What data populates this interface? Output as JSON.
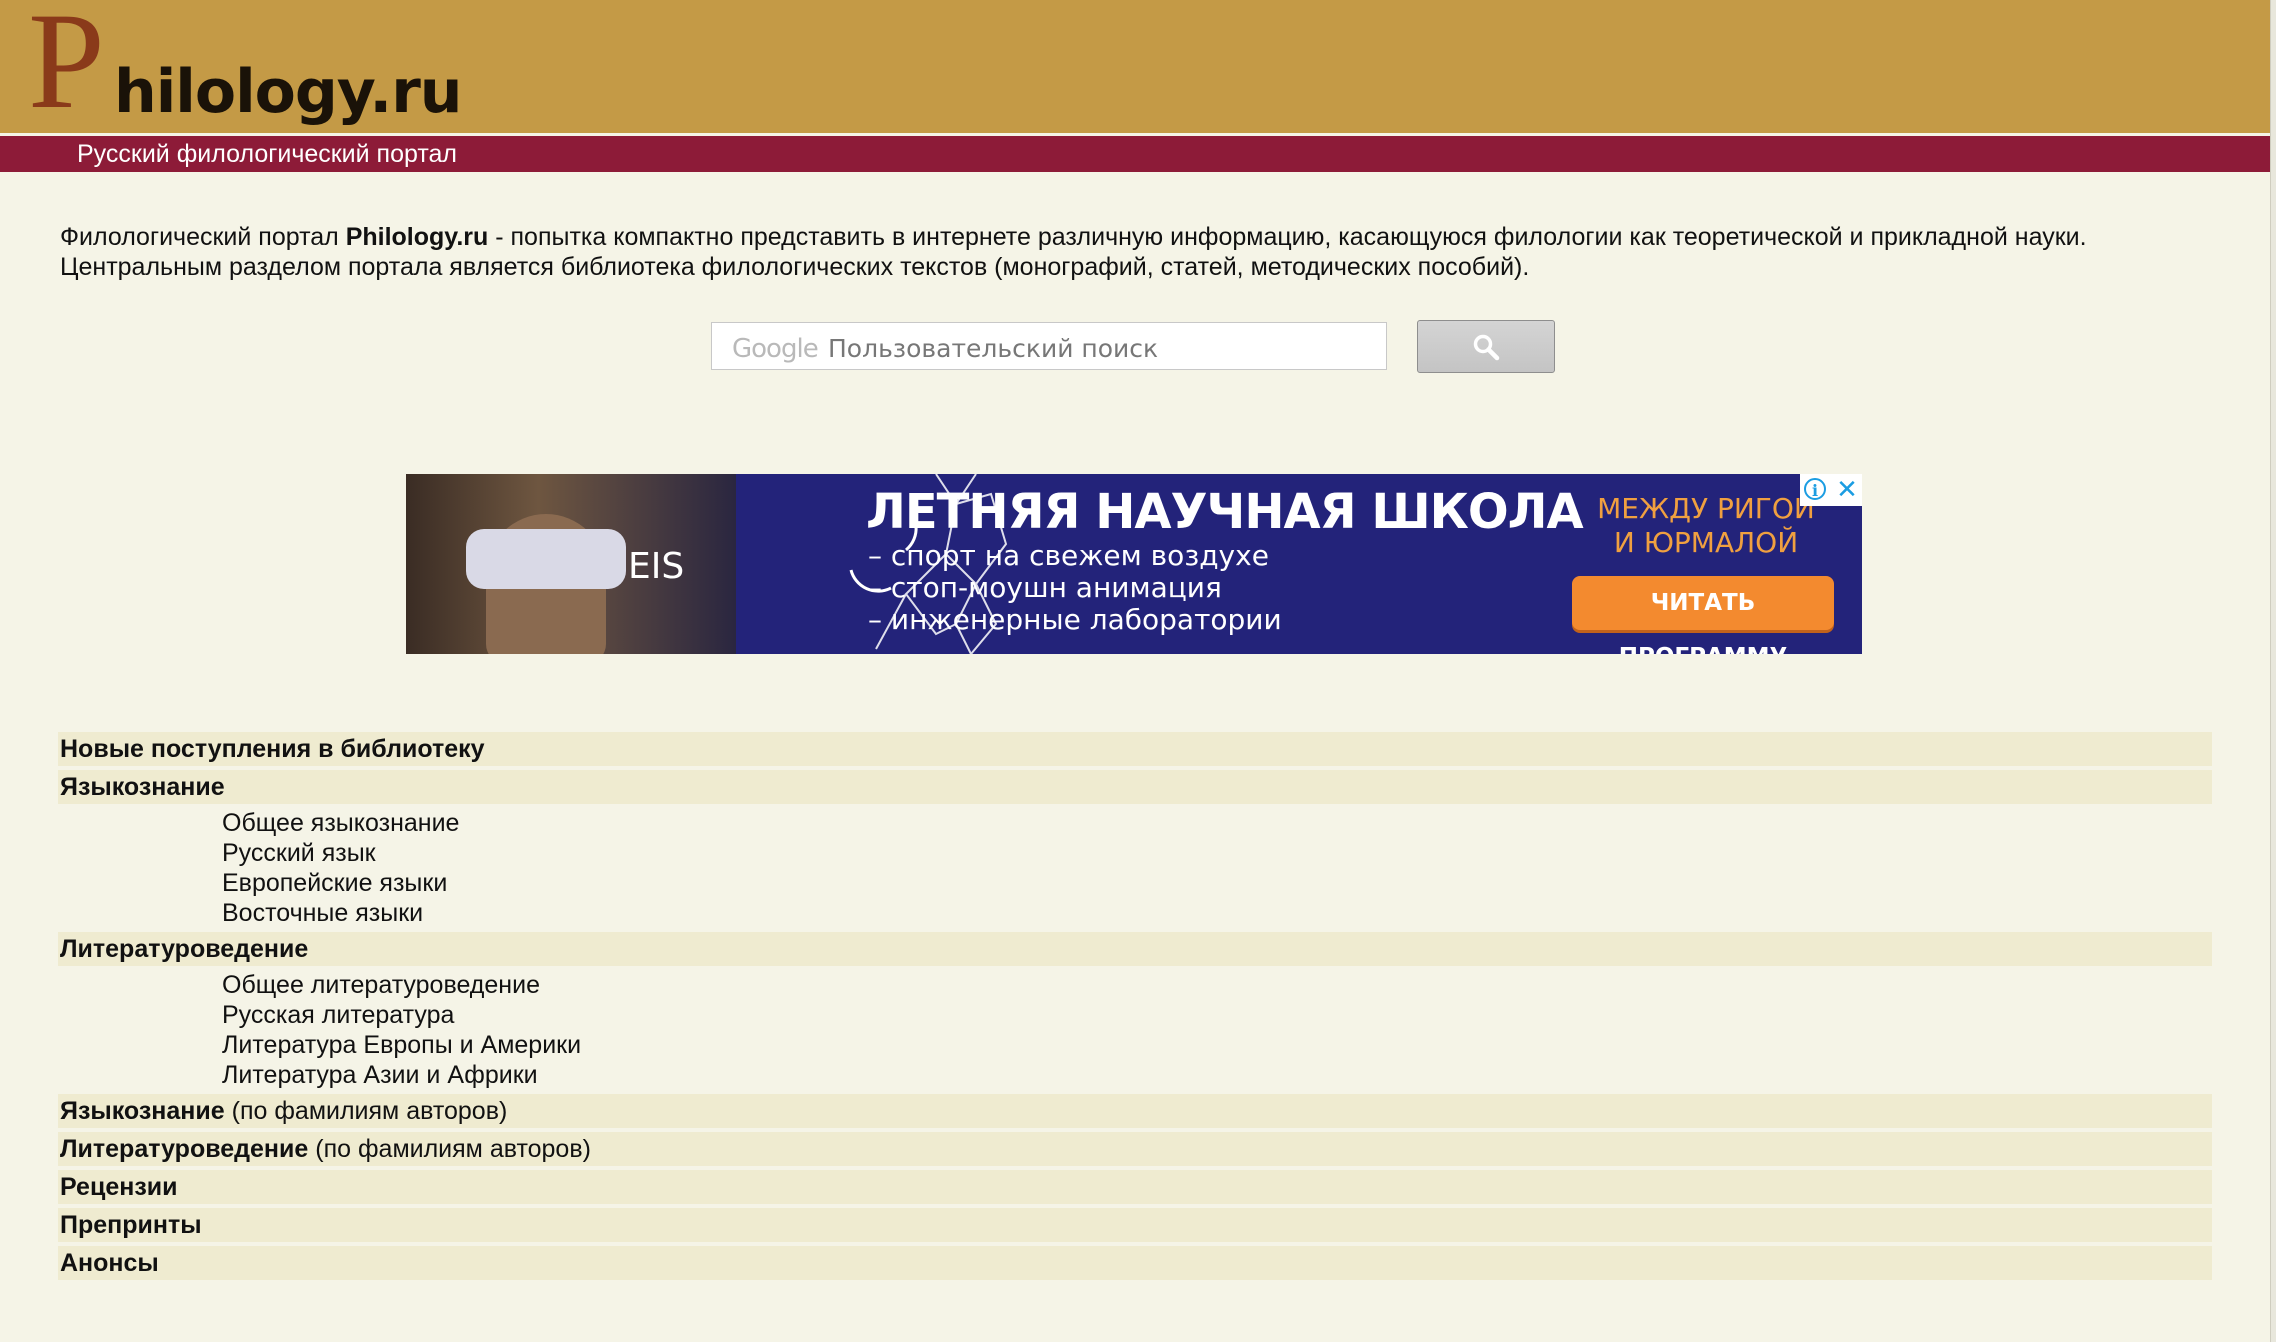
{
  "header": {
    "logo_p": "P",
    "logo_rest": "hilology.ru",
    "tagline": "Русский филологический портал"
  },
  "intro": {
    "line1_pre": "Филологический портал ",
    "line1_bold": "Philology.ru",
    "line1_post": " - попытка компактно представить в интернете различную информацию, касающуюся филологии как теоретической и прикладной науки.",
    "line2": "Центральным разделом портала является библиотека филологических текстов (монографий, статей, методических пособий)."
  },
  "search": {
    "google_label": "Google",
    "placeholder": "Пользовательский поиск",
    "value": ""
  },
  "ad": {
    "brand": "EIS",
    "title": "ЛЕТНЯЯ НАУЧНАЯ ШКОЛА",
    "bullets": [
      "– спорт на свежем воздухе",
      "– стоп-моушн анимация",
      "– инженерные лаборатории"
    ],
    "side_line1": "МЕЖДУ РИГОЙ",
    "side_line2": "И ЮРМАЛОЙ",
    "cta": "ЧИТАТЬ ПРОГРАММУ",
    "info_glyph": "i",
    "close_glyph": "✕"
  },
  "nav": {
    "new_arrivals": "Новые поступления в библиотеку",
    "linguistics": "Языкознание",
    "linguistics_items": [
      "Общее языкознание",
      "Русский язык",
      "Европейские языки",
      "Восточные языки"
    ],
    "literature": "Литературоведение",
    "literature_items": [
      "Общее литературоведение",
      "Русская литература",
      "Литература Европы и Америки",
      "Литература Азии и Африки"
    ],
    "linguistics_by_author_bold": "Языкознание",
    "linguistics_by_author_rest": " (по фамилиям авторов)",
    "literature_by_author_bold": "Литературоведение",
    "literature_by_author_rest": " (по фамилиям авторов)",
    "reviews": "Рецензии",
    "preprints": "Препринты",
    "announcements": "Анонсы"
  },
  "colors": {
    "header_gold": "#c49a46",
    "header_band": "#8d1b38",
    "page_bg": "#f5f4e7",
    "row_shade": "#efebd0",
    "ad_bg": "#23237a",
    "ad_cta": "#f38a2f"
  }
}
